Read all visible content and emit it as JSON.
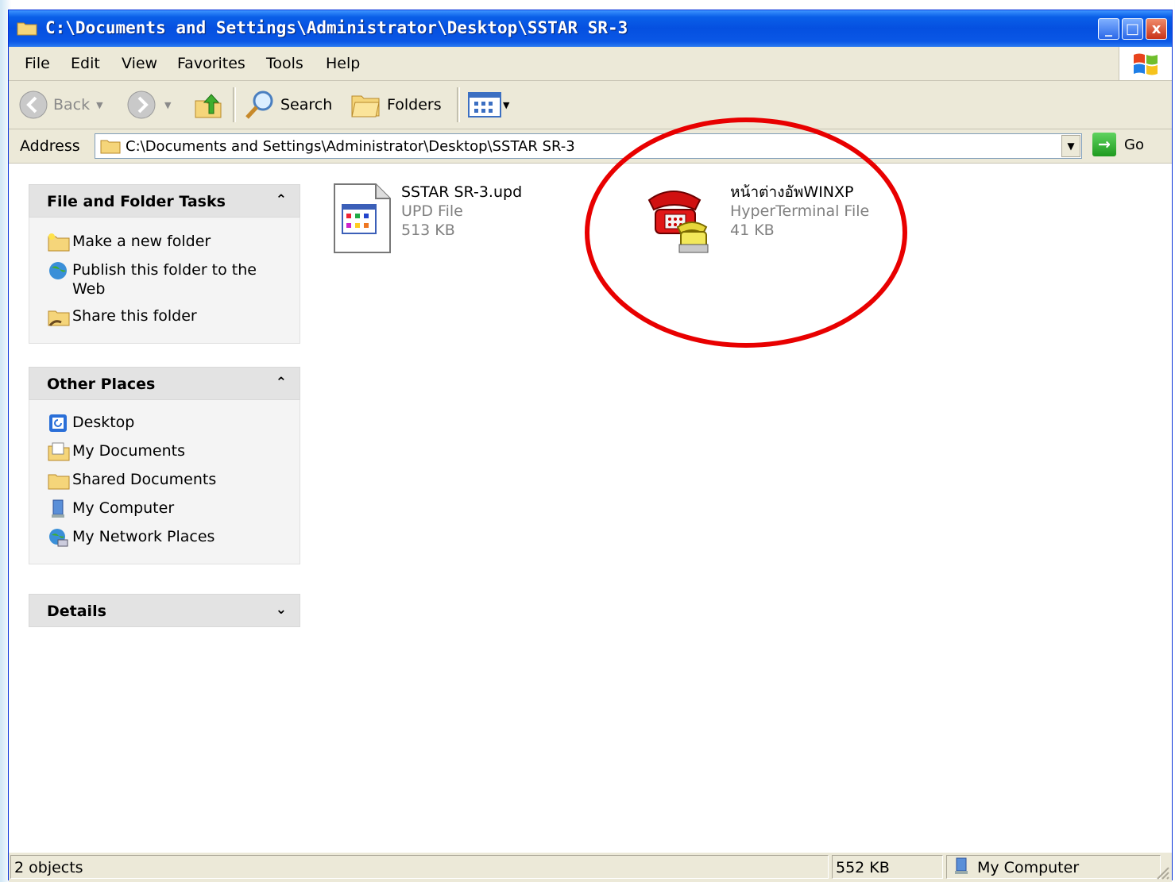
{
  "window": {
    "title": "C:\\Documents and Settings\\Administrator\\Desktop\\SSTAR SR-3",
    "controls": {
      "minimize": "_",
      "maximize": "□",
      "close": "x"
    }
  },
  "menu": [
    "File",
    "Edit",
    "View",
    "Favorites",
    "Tools",
    "Help"
  ],
  "toolbar": {
    "back": "Back",
    "search": "Search",
    "folders": "Folders"
  },
  "address": {
    "label": "Address",
    "value": "C:\\Documents and Settings\\Administrator\\Desktop\\SSTAR SR-3",
    "go": "Go"
  },
  "tasks": {
    "file_folder": {
      "title": "File and Folder Tasks",
      "items": [
        "Make a new folder",
        "Publish this folder to the Web",
        "Share this folder"
      ]
    },
    "other_places": {
      "title": "Other Places",
      "items": [
        "Desktop",
        "My Documents",
        "Shared Documents",
        "My Computer",
        "My Network Places"
      ]
    },
    "details": {
      "title": "Details"
    }
  },
  "files": [
    {
      "name": "SSTAR SR-3.upd",
      "type": "UPD File",
      "size": "513 KB"
    },
    {
      "name": "หน้าต่างอัพWINXP",
      "type": "HyperTerminal File",
      "size": "41 KB"
    }
  ],
  "status": {
    "objects": "2 objects",
    "size": "552 KB",
    "zone": "My Computer"
  },
  "colors": {
    "titlebar": "#0a5fe8",
    "annotation": "#e80000",
    "taskpane_header": "#e3e3e3"
  }
}
